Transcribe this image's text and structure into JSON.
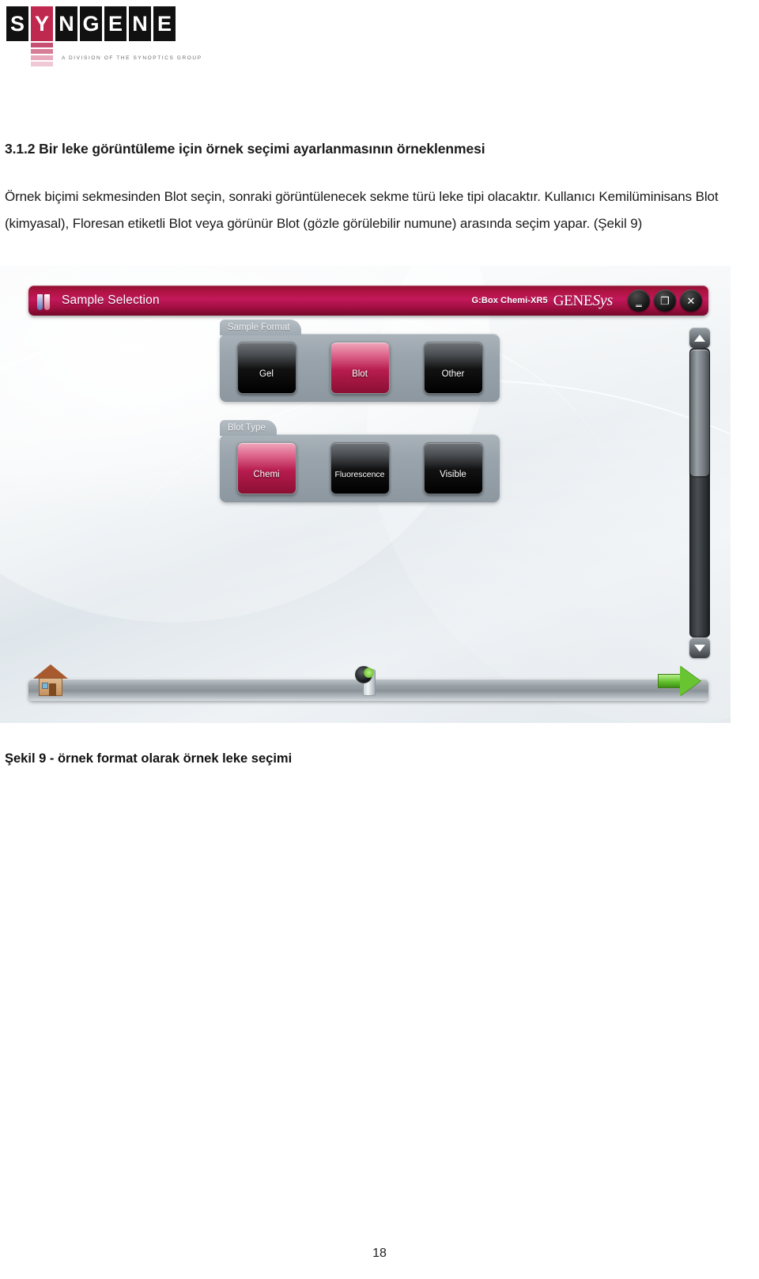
{
  "logo": {
    "letters": [
      "S",
      "Y",
      "N",
      "G",
      "E",
      "N",
      "E"
    ],
    "accent_index": 1,
    "accent_color": "#c0294f",
    "tagline": "A DIVISION OF THE SYNOPTICS GROUP"
  },
  "document": {
    "heading": "3.1.2 Bir leke görüntüleme için örnek seçimi ayarlanmasının örneklenmesi",
    "paragraph": "Örnek biçimi sekmesinden Blot seçin, sonraki görüntülenecek sekme türü leke tipi olacaktır. Kullanıcı Kemilüminisans Blot (kimyasal), Floresan etiketli Blot veya görünür Blot (gözle görülebilir numune) arasında seçim yapar. (Şekil 9)",
    "figure_caption": "Şekil 9 - örnek format olarak örnek leke seçimi",
    "page_number": "18"
  },
  "app": {
    "title": "Sample Selection",
    "device_model": "G:Box Chemi-XR5",
    "brand_primary": "GENE",
    "brand_secondary": "Sys",
    "accent_color": "#b71c4e",
    "window_buttons": [
      {
        "name": "minimize",
        "glyph": "‗"
      },
      {
        "name": "restore",
        "glyph": "❐"
      },
      {
        "name": "close",
        "glyph": "✕"
      }
    ],
    "groups": [
      {
        "tab_label": "Sample Format",
        "buttons": [
          {
            "label": "Gel",
            "selected": false
          },
          {
            "label": "Blot",
            "selected": true
          },
          {
            "label": "Other",
            "selected": false
          }
        ]
      },
      {
        "tab_label": "Blot Type",
        "buttons": [
          {
            "label": "Chemi",
            "selected": true
          },
          {
            "label": "Fluorescence",
            "selected": false
          },
          {
            "label": "Visible",
            "selected": false
          }
        ]
      }
    ],
    "toolbar": {
      "home": "home-icon",
      "capture": "camera-icon",
      "next": "next-arrow-icon"
    },
    "scrollbar": {
      "up": "scroll-up-arrow",
      "down": "scroll-down-arrow"
    }
  }
}
